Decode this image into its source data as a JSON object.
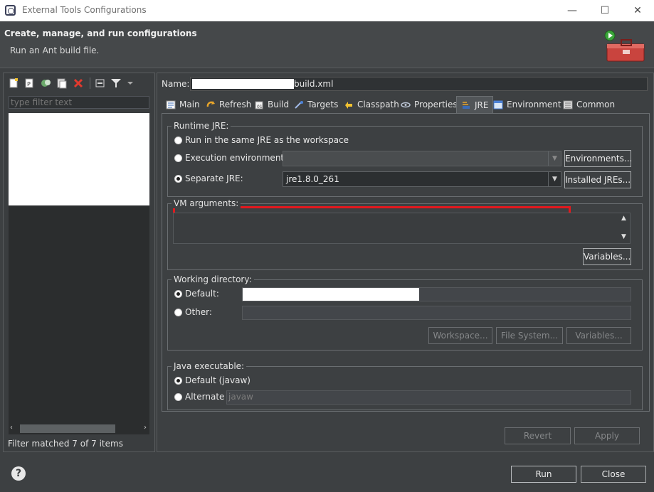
{
  "window": {
    "title": "External Tools Configurations",
    "minimize": "—",
    "maximize": "☐",
    "close": "✕"
  },
  "header": {
    "title": "Create, manage, and run configurations",
    "subtitle": "Run an Ant build file."
  },
  "left": {
    "filter_placeholder": "type filter text",
    "filter_status": "Filter matched 7 of 7 items",
    "toolbar_icons": [
      "new-configuration-icon",
      "new-prototype-icon",
      "duplicate-icon",
      "export-icon",
      "delete-icon",
      "collapse-all-icon",
      "filter-icon",
      "view-menu-icon"
    ]
  },
  "right": {
    "name_label": "Name:",
    "name_value": "build.xml",
    "tabs": [
      {
        "label": "Main",
        "icon": "main-tab-icon"
      },
      {
        "label": "Refresh",
        "icon": "refresh-icon"
      },
      {
        "label": "Build",
        "icon": "build-icon"
      },
      {
        "label": "Targets",
        "icon": "targets-icon"
      },
      {
        "label": "Classpath",
        "icon": "classpath-icon"
      },
      {
        "label": "Properties",
        "icon": "properties-icon"
      },
      {
        "label": "JRE",
        "icon": "jre-icon"
      },
      {
        "label": "Environment",
        "icon": "environment-icon"
      },
      {
        "label": "Common",
        "icon": "common-icon"
      }
    ],
    "active_tab": "JRE",
    "runtime_jre": {
      "legend": "Runtime JRE:",
      "same_jre": "Run in the same JRE as the workspace",
      "exec_env": "Execution environment:",
      "separate_jre": "Separate JRE:",
      "separate_value": "jre1.8.0_261",
      "environments_btn": "Environments...",
      "installed_btn": "Installed JREs..."
    },
    "vm_args": {
      "legend": "VM arguments:",
      "variables_btn": "Variables..."
    },
    "working_dir": {
      "legend": "Working directory:",
      "default": "Default:",
      "other": "Other:",
      "workspace_btn": "Workspace...",
      "filesystem_btn": "File System...",
      "variables_btn": "Variables..."
    },
    "java_exec": {
      "legend": "Java executable:",
      "default": "Default (javaw)",
      "alternate": "Alternate",
      "alternate_value": "javaw"
    },
    "revert_btn": "Revert",
    "apply_btn": "Apply"
  },
  "footer": {
    "help": "?",
    "run_btn": "Run",
    "close_btn": "Close"
  }
}
